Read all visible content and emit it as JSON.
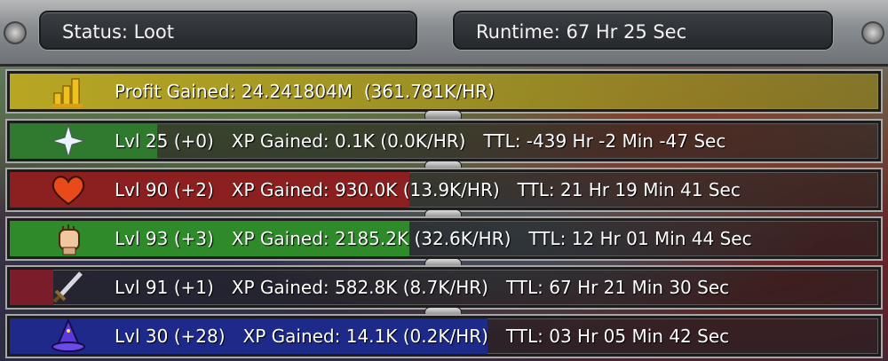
{
  "header": {
    "status": "Status: Loot",
    "runtime": "Runtime: 67 Hr 25 Sec"
  },
  "profit": {
    "text": "Profit Gained: 24.241804M  (361.781K/HR)",
    "color": "#b8a623"
  },
  "skills": [
    {
      "icon": "sparkle-icon",
      "level": "Lvl 25 (+0)",
      "xp": "XP Gained: 0.1K (0.0K/HR)",
      "ttl": "TTL: -439 Hr -2 Min -47 Sec",
      "color": "#2f7a2f",
      "progress": 0.17
    },
    {
      "icon": "heart-icon",
      "level": "Lvl 90 (+2)",
      "xp": "XP Gained: 930.0K (13.9K/HR)",
      "ttl": "TTL: 21 Hr 19 Min 41 Sec",
      "color": "#8c1f1f",
      "progress": 0.46
    },
    {
      "icon": "fist-icon",
      "level": "Lvl 93 (+3)",
      "xp": "XP Gained: 2185.2K (32.6K/HR)",
      "ttl": "TTL: 12 Hr 01 Min 44 Sec",
      "color": "#2f8a2a",
      "progress": 0.46
    },
    {
      "icon": "sword-icon",
      "level": "Lvl 91 (+1)",
      "xp": "XP Gained: 582.8K (8.7K/HR)",
      "ttl": "TTL: 67 Hr 21 Min 30 Sec",
      "color": "#7a1c2a",
      "progress": 0.05
    },
    {
      "icon": "wizard-hat-icon",
      "level": "Lvl 30 (+28)",
      "xp": "XP Gained: 14.1K (0.2K/HR)",
      "ttl": "TTL: 03 Hr 05 Min 42 Sec",
      "color": "#1d2a8a",
      "progress": 0.55
    }
  ]
}
